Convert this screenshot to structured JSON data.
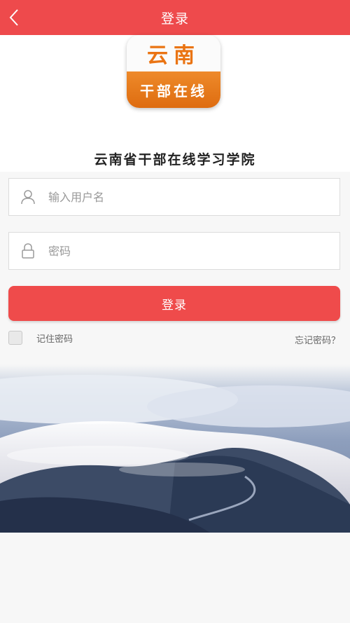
{
  "header": {
    "title": "登录",
    "back_icon": "chevron-left-icon"
  },
  "brand": {
    "logo_line1": "云南",
    "logo_line2": "干部在线",
    "org_name": "云南省干部在线学习学院"
  },
  "form": {
    "username": {
      "placeholder": "输入用户名",
      "value": "",
      "icon": "user-icon"
    },
    "password": {
      "placeholder": "密码",
      "value": "",
      "icon": "lock-icon"
    },
    "login_label": "登录",
    "remember_label": "记住密码",
    "forgot_label": "忘记密码？"
  },
  "colors": {
    "primary": "#ee4a4c",
    "background": "#f7f7f7",
    "logo_orange": "#ea7413"
  }
}
